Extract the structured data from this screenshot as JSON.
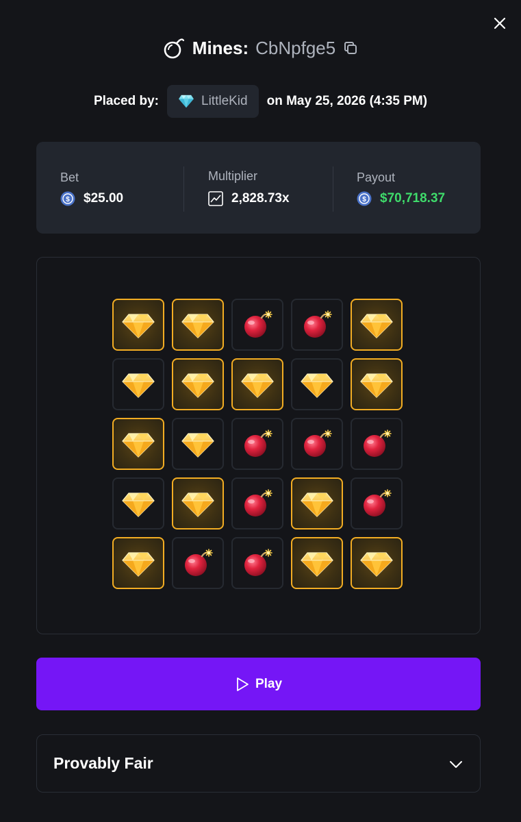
{
  "header": {
    "title": "Mines:",
    "game_id": "CbNpfge5",
    "icon": "bomb-icon",
    "copy_icon": "copy-icon",
    "close_icon": "close-icon"
  },
  "placed": {
    "label": "Placed by:",
    "username": "LittleKid",
    "user_icon": "diamond-icon",
    "date": "on May 25, 2026 (4:35 PM)"
  },
  "stats": {
    "bet": {
      "label": "Bet",
      "value": "$25.00",
      "icon": "coin-icon"
    },
    "multiplier": {
      "label": "Multiplier",
      "value": "2,828.73x",
      "icon": "chart-icon"
    },
    "payout": {
      "label": "Payout",
      "value": "$70,718.37",
      "icon": "coin-icon",
      "color": "#3fdb6b"
    }
  },
  "board": {
    "rows": 5,
    "cols": 5,
    "tiles": [
      {
        "type": "gem",
        "revealed": true
      },
      {
        "type": "gem",
        "revealed": true
      },
      {
        "type": "mine",
        "revealed": false
      },
      {
        "type": "mine",
        "revealed": false
      },
      {
        "type": "gem",
        "revealed": true
      },
      {
        "type": "gem",
        "revealed": false
      },
      {
        "type": "gem",
        "revealed": true
      },
      {
        "type": "gem",
        "revealed": true
      },
      {
        "type": "gem",
        "revealed": false
      },
      {
        "type": "gem",
        "revealed": true
      },
      {
        "type": "gem",
        "revealed": true
      },
      {
        "type": "gem",
        "revealed": false
      },
      {
        "type": "mine",
        "revealed": false
      },
      {
        "type": "mine",
        "revealed": false
      },
      {
        "type": "mine",
        "revealed": false
      },
      {
        "type": "gem",
        "revealed": false
      },
      {
        "type": "gem",
        "revealed": true
      },
      {
        "type": "mine",
        "revealed": false
      },
      {
        "type": "gem",
        "revealed": true
      },
      {
        "type": "mine",
        "revealed": false
      },
      {
        "type": "gem",
        "revealed": true
      },
      {
        "type": "mine",
        "revealed": false
      },
      {
        "type": "mine",
        "revealed": false
      },
      {
        "type": "gem",
        "revealed": true
      },
      {
        "type": "gem",
        "revealed": true
      }
    ]
  },
  "play_button": {
    "label": "Play",
    "icon": "play-icon",
    "color": "#7516f6"
  },
  "provably_fair": {
    "title": "Provably Fair",
    "icon": "chevron-down-icon"
  },
  "colors": {
    "background": "#141519",
    "panel": "#22262e",
    "accent_gold": "#f3ad23"
  }
}
